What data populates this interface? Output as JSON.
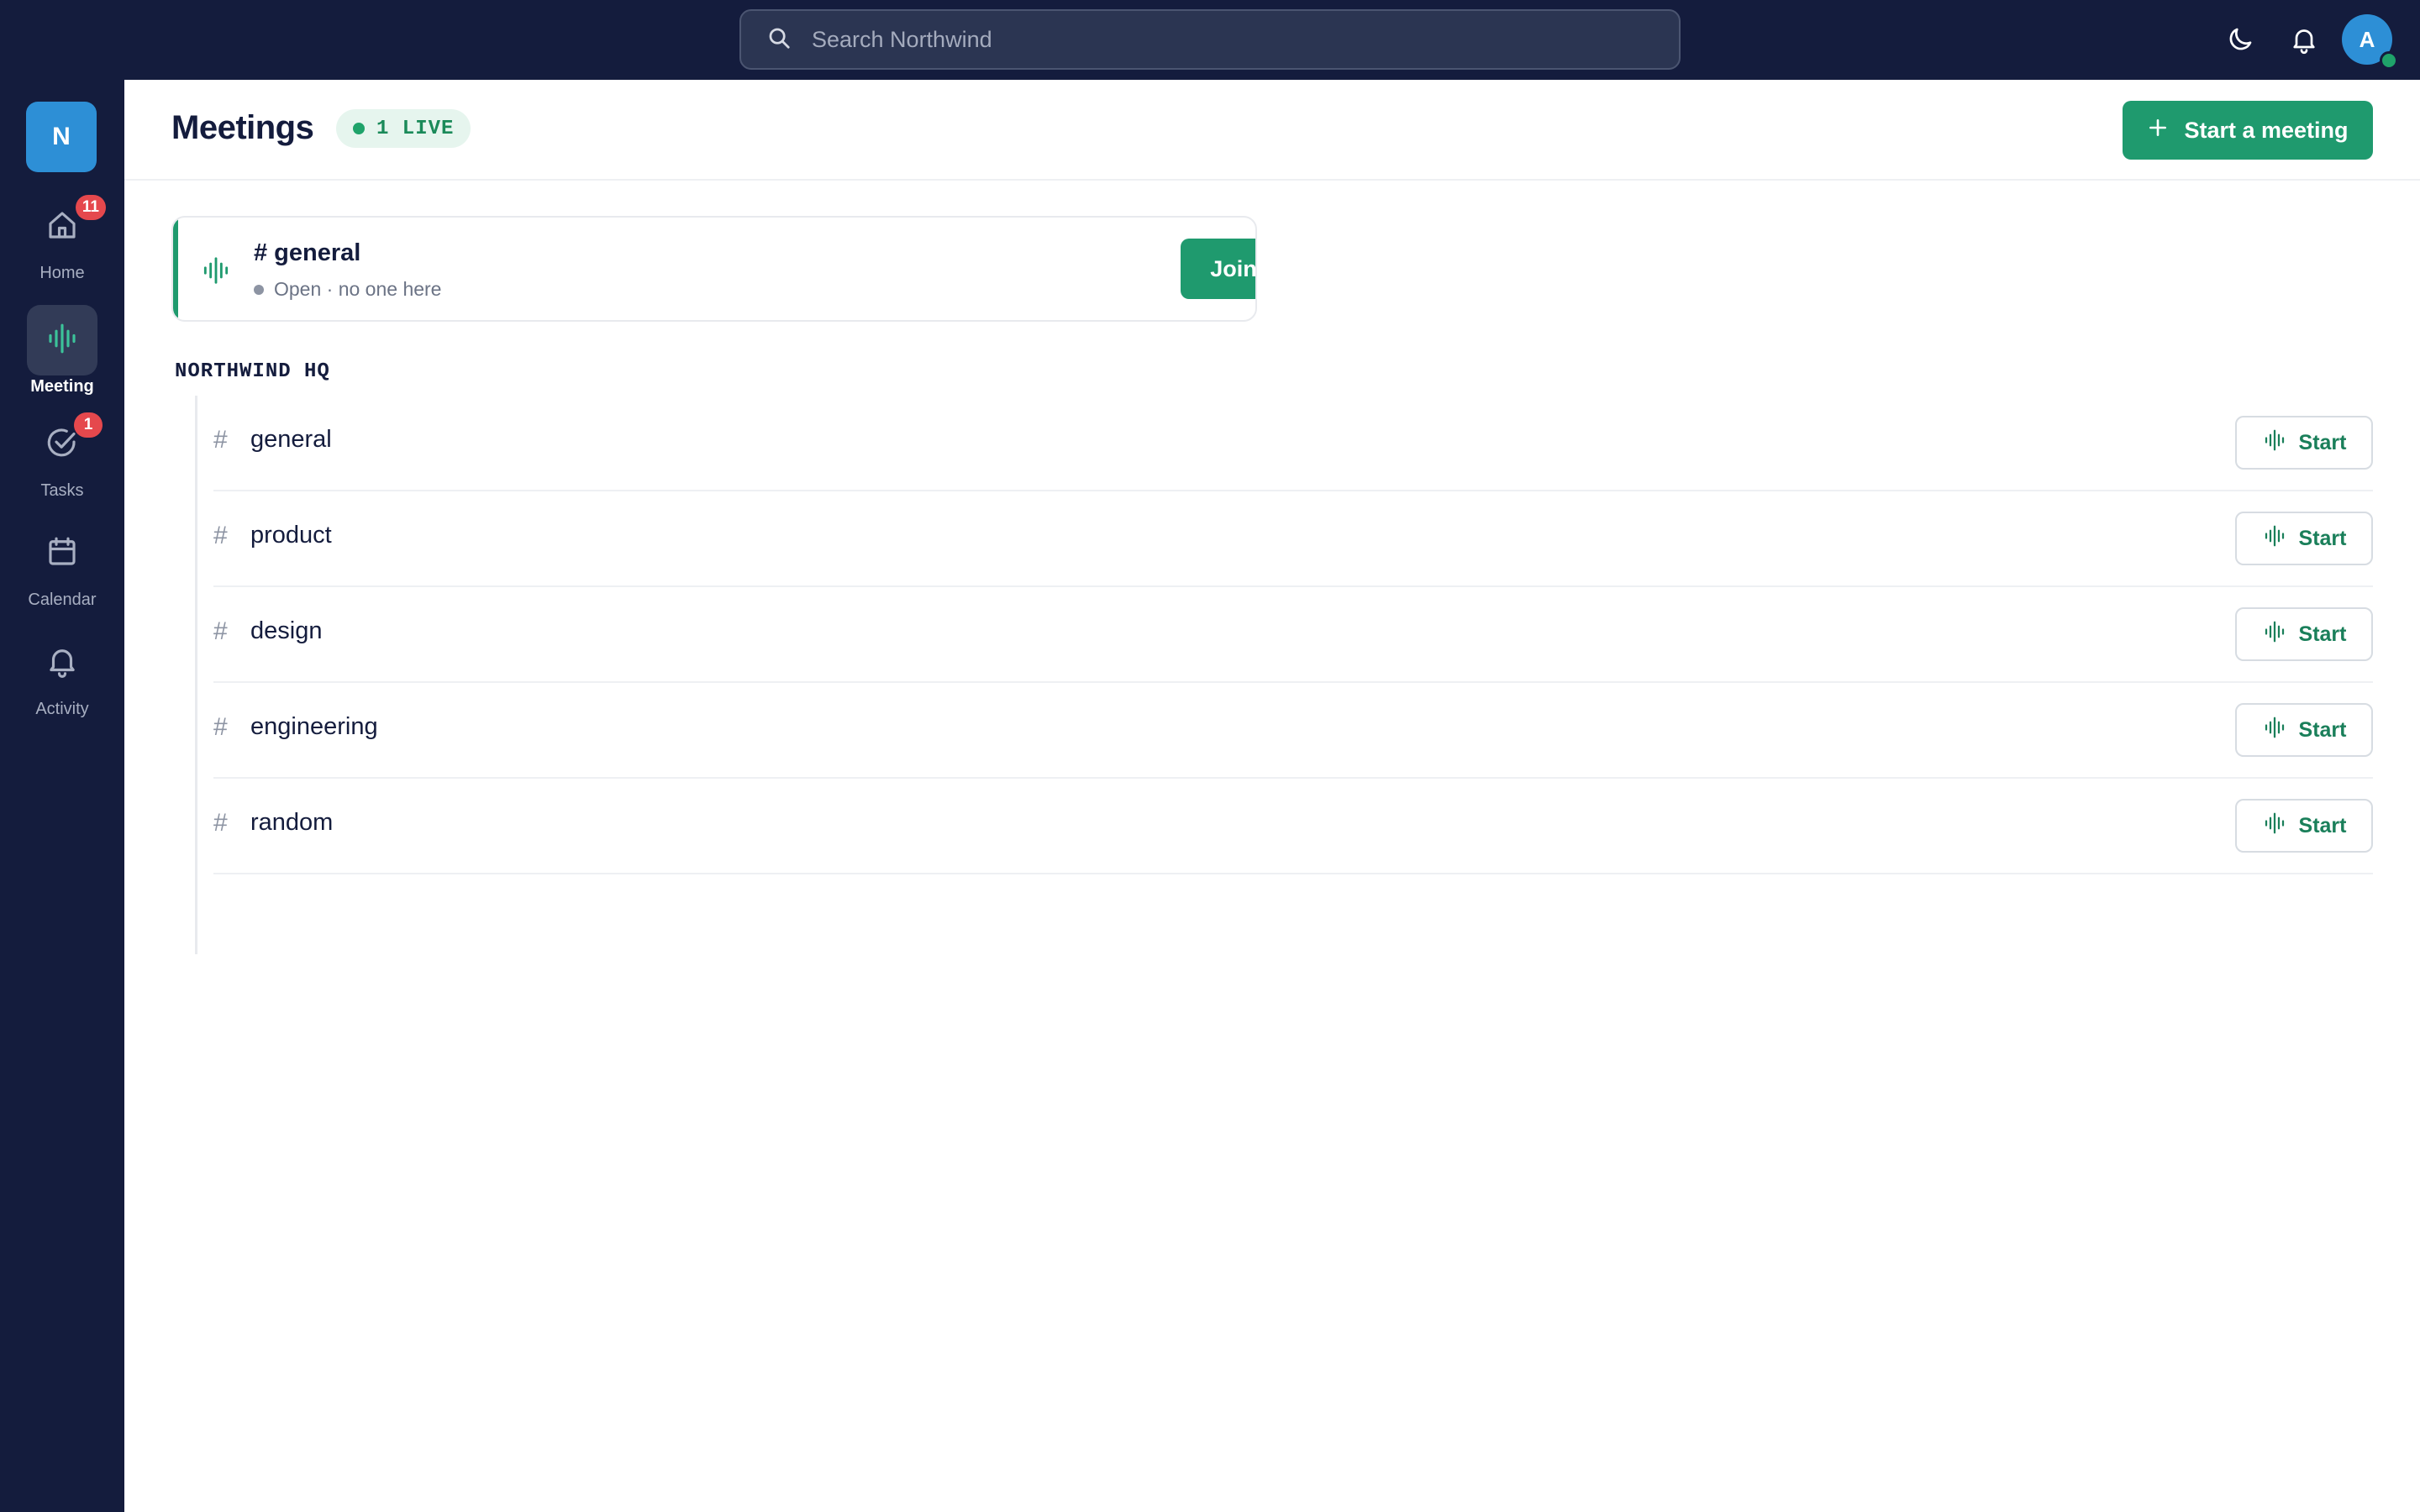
{
  "search": {
    "placeholder": "Search Northwind"
  },
  "user": {
    "avatar_letter": "A"
  },
  "workspace": {
    "letter": "N"
  },
  "sidebar": {
    "items": [
      {
        "label": "Home",
        "badge": "11",
        "active": false
      },
      {
        "label": "Meeting",
        "badge": "",
        "active": true
      },
      {
        "label": "Tasks",
        "badge": "1",
        "active": false
      },
      {
        "label": "Calendar",
        "badge": "",
        "active": false
      },
      {
        "label": "Activity",
        "badge": "",
        "active": false
      }
    ]
  },
  "header": {
    "title": "Meetings",
    "live_label": "1 LIVE",
    "start_button": "Start a meeting"
  },
  "live_card": {
    "channel": "# general",
    "status": "Open · no one here",
    "join_label": "Join"
  },
  "section": {
    "title": "NORTHWIND HQ",
    "hash": "#",
    "start_label": "Start",
    "channels": [
      "general",
      "product",
      "design",
      "engineering",
      "random"
    ]
  },
  "colors": {
    "navy": "#141c3d",
    "accent_green": "#1f9a6e",
    "badge_red": "#e5484d",
    "avatar_blue": "#2d8fd6"
  }
}
